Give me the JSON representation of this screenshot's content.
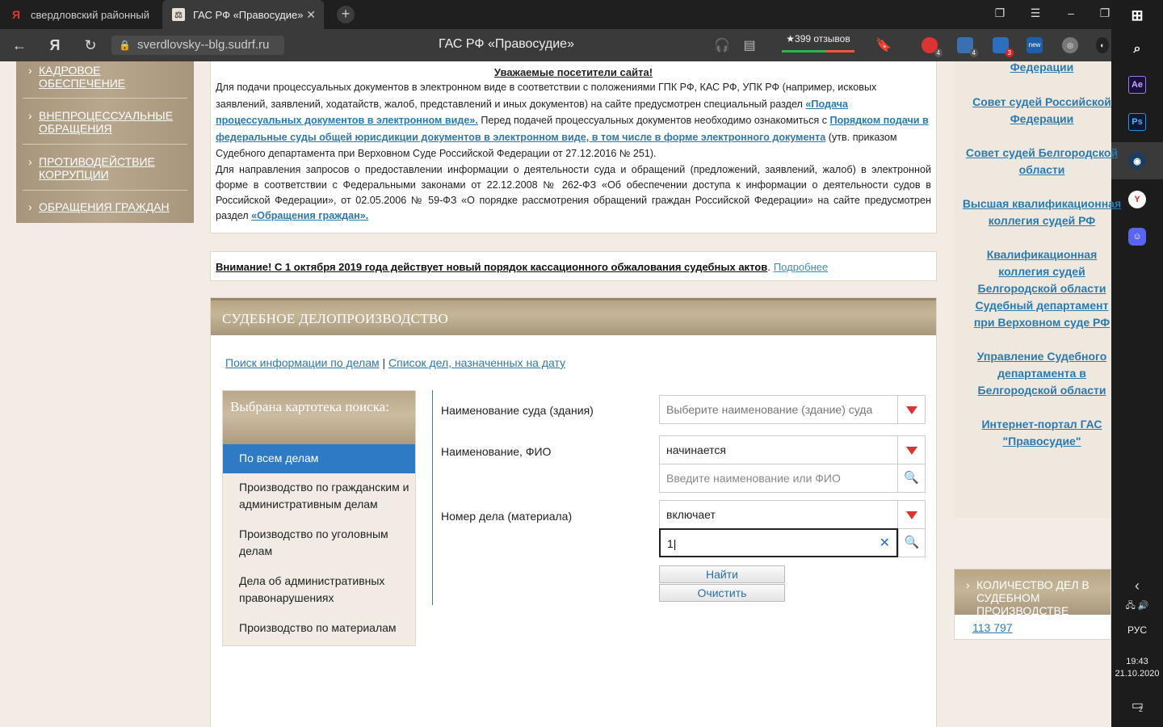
{
  "browser": {
    "tabs": [
      {
        "label": "свердловский районный с",
        "favicon": "Я"
      },
      {
        "label": "ГАС РФ «Правосудие»",
        "favicon": "⚖"
      }
    ],
    "url": "sverdlovsky--blg.sudrf.ru",
    "page_title": "ГАС РФ «Правосудие»",
    "reviews": "★399 отзывов",
    "ext_counts": [
      "4",
      "4",
      "3"
    ],
    "ext_new_label": "new"
  },
  "left_menu": {
    "items": [
      "КАДРОВОЕ ОБЕСПЕЧЕНИЕ",
      "ВНЕПРОЦЕССУАЛЬНЫЕ ОБРАЩЕНИЯ",
      "ПРОТИВОДЕЙСТВИЕ КОРРУПЦИИ",
      "ОБРАЩЕНИЯ ГРАЖДАН"
    ]
  },
  "notice": {
    "title": "Уважаемые посетители сайта!",
    "p1_a": "Для подачи процессуальных документов в электронном виде в соответствии с положениями ГПК РФ, КАС РФ, УПК РФ (например, исковых заявлений, заявлений, ходатайств, жалоб, представлений и иных документов) на сайте предусмотрен специальный раздел ",
    "p1_link1": "«Подача процессуальных документов в электронном виде».",
    "p1_b": " Перед подачей процессуальных документов необходимо ознакомиться с ",
    "p1_link2": "Порядком подачи в федеральные суды общей юрисдикции документов в электронном виде, в том числе в форме электронного документа",
    "p1_c": " (утв. приказом Судебного департамента при Верховном Суде Российской Федерации от 27.12.2016 № 251).",
    "p2_a": "Для направления запросов о предоставлении информации о деятельности суда и обращений (предложений, заявлений, жалоб) в электронной форме в соответствии с Федеральными законами от 22.12.2008 № 262-ФЗ «Об обеспечении доступа к информации о деятельности судов в Российской Федерации», от 02.05.2006 № 59-ФЗ «О порядке рассмотрения обращений граждан Российской Федерации» на сайте предусмотрен раздел ",
    "p2_link": "«Обращения граждан»."
  },
  "warning": {
    "text": "Внимание! С 1 октября 2019 года действует новый порядок кассационного обжалования судебных актов",
    "dot": ".",
    "more": "Подробнее"
  },
  "court_section": {
    "title": "СУДЕБНОЕ ДЕЛОПРОИЗВОДСТВО",
    "link_search": "Поиск информации по делам",
    "separator": "|",
    "link_list": "Список дел, назначенных на дату",
    "file_panel_title": "Выбрана картотека поиска:",
    "file_items": [
      "По всем делам",
      "Производство по гражданским и административным делам",
      "Производство по уголовным делам",
      "Дела об административных правонарушениях",
      "Производство по материалам"
    ],
    "form": {
      "court_label": "Наименование суда (здания)",
      "court_placeholder": "Выберите наименование (здание) суда",
      "name_label": "Наименование, ФИО",
      "name_mode": "начинается",
      "name_placeholder": "Введите наименование или ФИО",
      "case_label": "Номер дела (материала)",
      "case_mode": "включает",
      "case_value": "1|",
      "find_button": "Найти",
      "clear_button": "Очистить"
    }
  },
  "right_column": {
    "links": [
      "Федерации",
      "Совет судей Российской Федерации",
      "Совет судей Белгородской области",
      "Высшая квалификационная коллегия судей РФ",
      "Квалификационная коллегия судей Белгородской области",
      "Судебный департамент при Верховном суде РФ",
      "Управление Судебного департамента в Белгородской области",
      "Интернет-портал ГАС \"Правосудие\""
    ],
    "counter_title": "КОЛИЧЕСТВО ДЕЛ В СУДЕБНОМ ПРОИЗВОДСТВЕ",
    "counter_value": "113 797"
  },
  "taskbar": {
    "lang": "РУС",
    "time": "19:43",
    "date": "21.10.2020",
    "notif_count": "2"
  }
}
